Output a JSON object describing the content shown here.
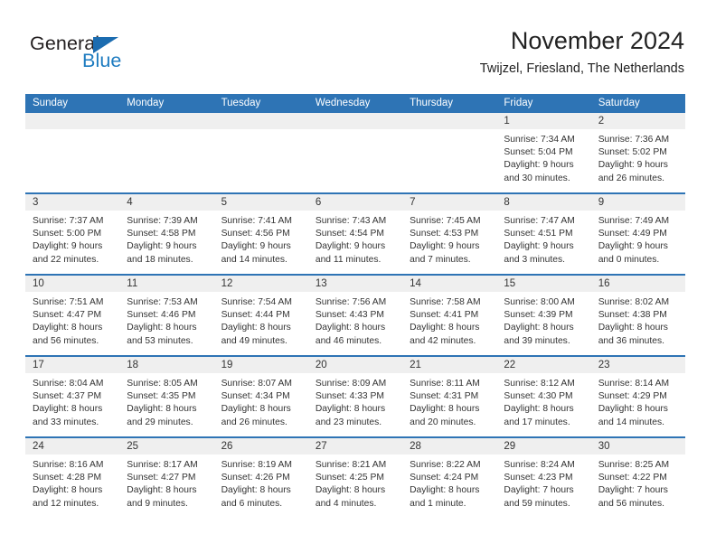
{
  "brand": {
    "name_part1": "General",
    "name_part2": "Blue",
    "accent_color": "#1b6cb0"
  },
  "header": {
    "month_title": "November 2024",
    "location": "Twijzel, Friesland, The Netherlands"
  },
  "calendar": {
    "header_bg": "#2e74b5",
    "daynum_bg": "#efefef",
    "weekdays": [
      "Sunday",
      "Monday",
      "Tuesday",
      "Wednesday",
      "Thursday",
      "Friday",
      "Saturday"
    ],
    "weeks": [
      [
        {
          "day": "",
          "empty": true,
          "lines": []
        },
        {
          "day": "",
          "empty": true,
          "lines": []
        },
        {
          "day": "",
          "empty": true,
          "lines": []
        },
        {
          "day": "",
          "empty": true,
          "lines": []
        },
        {
          "day": "",
          "empty": true,
          "lines": []
        },
        {
          "day": "1",
          "empty": false,
          "lines": [
            "Sunrise: 7:34 AM",
            "Sunset: 5:04 PM",
            "Daylight: 9 hours",
            "and 30 minutes."
          ]
        },
        {
          "day": "2",
          "empty": false,
          "lines": [
            "Sunrise: 7:36 AM",
            "Sunset: 5:02 PM",
            "Daylight: 9 hours",
            "and 26 minutes."
          ]
        }
      ],
      [
        {
          "day": "3",
          "empty": false,
          "lines": [
            "Sunrise: 7:37 AM",
            "Sunset: 5:00 PM",
            "Daylight: 9 hours",
            "and 22 minutes."
          ]
        },
        {
          "day": "4",
          "empty": false,
          "lines": [
            "Sunrise: 7:39 AM",
            "Sunset: 4:58 PM",
            "Daylight: 9 hours",
            "and 18 minutes."
          ]
        },
        {
          "day": "5",
          "empty": false,
          "lines": [
            "Sunrise: 7:41 AM",
            "Sunset: 4:56 PM",
            "Daylight: 9 hours",
            "and 14 minutes."
          ]
        },
        {
          "day": "6",
          "empty": false,
          "lines": [
            "Sunrise: 7:43 AM",
            "Sunset: 4:54 PM",
            "Daylight: 9 hours",
            "and 11 minutes."
          ]
        },
        {
          "day": "7",
          "empty": false,
          "lines": [
            "Sunrise: 7:45 AM",
            "Sunset: 4:53 PM",
            "Daylight: 9 hours",
            "and 7 minutes."
          ]
        },
        {
          "day": "8",
          "empty": false,
          "lines": [
            "Sunrise: 7:47 AM",
            "Sunset: 4:51 PM",
            "Daylight: 9 hours",
            "and 3 minutes."
          ]
        },
        {
          "day": "9",
          "empty": false,
          "lines": [
            "Sunrise: 7:49 AM",
            "Sunset: 4:49 PM",
            "Daylight: 9 hours",
            "and 0 minutes."
          ]
        }
      ],
      [
        {
          "day": "10",
          "empty": false,
          "lines": [
            "Sunrise: 7:51 AM",
            "Sunset: 4:47 PM",
            "Daylight: 8 hours",
            "and 56 minutes."
          ]
        },
        {
          "day": "11",
          "empty": false,
          "lines": [
            "Sunrise: 7:53 AM",
            "Sunset: 4:46 PM",
            "Daylight: 8 hours",
            "and 53 minutes."
          ]
        },
        {
          "day": "12",
          "empty": false,
          "lines": [
            "Sunrise: 7:54 AM",
            "Sunset: 4:44 PM",
            "Daylight: 8 hours",
            "and 49 minutes."
          ]
        },
        {
          "day": "13",
          "empty": false,
          "lines": [
            "Sunrise: 7:56 AM",
            "Sunset: 4:43 PM",
            "Daylight: 8 hours",
            "and 46 minutes."
          ]
        },
        {
          "day": "14",
          "empty": false,
          "lines": [
            "Sunrise: 7:58 AM",
            "Sunset: 4:41 PM",
            "Daylight: 8 hours",
            "and 42 minutes."
          ]
        },
        {
          "day": "15",
          "empty": false,
          "lines": [
            "Sunrise: 8:00 AM",
            "Sunset: 4:39 PM",
            "Daylight: 8 hours",
            "and 39 minutes."
          ]
        },
        {
          "day": "16",
          "empty": false,
          "lines": [
            "Sunrise: 8:02 AM",
            "Sunset: 4:38 PM",
            "Daylight: 8 hours",
            "and 36 minutes."
          ]
        }
      ],
      [
        {
          "day": "17",
          "empty": false,
          "lines": [
            "Sunrise: 8:04 AM",
            "Sunset: 4:37 PM",
            "Daylight: 8 hours",
            "and 33 minutes."
          ]
        },
        {
          "day": "18",
          "empty": false,
          "lines": [
            "Sunrise: 8:05 AM",
            "Sunset: 4:35 PM",
            "Daylight: 8 hours",
            "and 29 minutes."
          ]
        },
        {
          "day": "19",
          "empty": false,
          "lines": [
            "Sunrise: 8:07 AM",
            "Sunset: 4:34 PM",
            "Daylight: 8 hours",
            "and 26 minutes."
          ]
        },
        {
          "day": "20",
          "empty": false,
          "lines": [
            "Sunrise: 8:09 AM",
            "Sunset: 4:33 PM",
            "Daylight: 8 hours",
            "and 23 minutes."
          ]
        },
        {
          "day": "21",
          "empty": false,
          "lines": [
            "Sunrise: 8:11 AM",
            "Sunset: 4:31 PM",
            "Daylight: 8 hours",
            "and 20 minutes."
          ]
        },
        {
          "day": "22",
          "empty": false,
          "lines": [
            "Sunrise: 8:12 AM",
            "Sunset: 4:30 PM",
            "Daylight: 8 hours",
            "and 17 minutes."
          ]
        },
        {
          "day": "23",
          "empty": false,
          "lines": [
            "Sunrise: 8:14 AM",
            "Sunset: 4:29 PM",
            "Daylight: 8 hours",
            "and 14 minutes."
          ]
        }
      ],
      [
        {
          "day": "24",
          "empty": false,
          "lines": [
            "Sunrise: 8:16 AM",
            "Sunset: 4:28 PM",
            "Daylight: 8 hours",
            "and 12 minutes."
          ]
        },
        {
          "day": "25",
          "empty": false,
          "lines": [
            "Sunrise: 8:17 AM",
            "Sunset: 4:27 PM",
            "Daylight: 8 hours",
            "and 9 minutes."
          ]
        },
        {
          "day": "26",
          "empty": false,
          "lines": [
            "Sunrise: 8:19 AM",
            "Sunset: 4:26 PM",
            "Daylight: 8 hours",
            "and 6 minutes."
          ]
        },
        {
          "day": "27",
          "empty": false,
          "lines": [
            "Sunrise: 8:21 AM",
            "Sunset: 4:25 PM",
            "Daylight: 8 hours",
            "and 4 minutes."
          ]
        },
        {
          "day": "28",
          "empty": false,
          "lines": [
            "Sunrise: 8:22 AM",
            "Sunset: 4:24 PM",
            "Daylight: 8 hours",
            "and 1 minute."
          ]
        },
        {
          "day": "29",
          "empty": false,
          "lines": [
            "Sunrise: 8:24 AM",
            "Sunset: 4:23 PM",
            "Daylight: 7 hours",
            "and 59 minutes."
          ]
        },
        {
          "day": "30",
          "empty": false,
          "lines": [
            "Sunrise: 8:25 AM",
            "Sunset: 4:22 PM",
            "Daylight: 7 hours",
            "and 56 minutes."
          ]
        }
      ]
    ]
  }
}
